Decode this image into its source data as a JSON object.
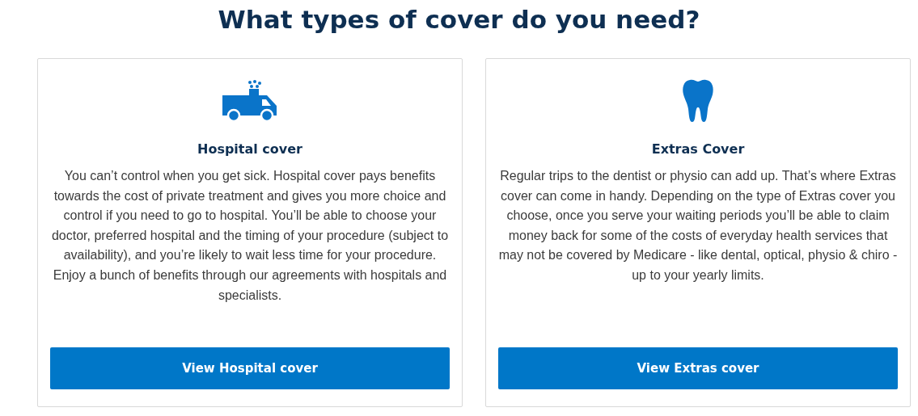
{
  "heading": "What types of cover do you need?",
  "cards": [
    {
      "kind": "ambulance",
      "title": "Hospital cover",
      "text": "You can’t control when you get sick. Hospital cover pays benefits towards the cost of private treatment and gives you more choice and control if you need to go to hospital. You’ll be able to choose your doctor, preferred hospital and the timing of your procedure (subject to availability), and you’re likely to wait less time for your procedure. Enjoy a bunch of benefits through our agreements with hospitals and specialists.",
      "button": "View Hospital cover"
    },
    {
      "kind": "tooth",
      "title": "Extras Cover",
      "text": "Regular trips to the dentist or physio can add up. That’s where Extras cover can come in handy. Depending on the type of Extras cover you choose, once you serve your waiting periods you’ll be able to claim money back for some of the costs of everyday health services that may not be covered by Medicare - like dental, optical, physio & chiro - up to your yearly limits.",
      "button": "View Extras cover"
    }
  ]
}
